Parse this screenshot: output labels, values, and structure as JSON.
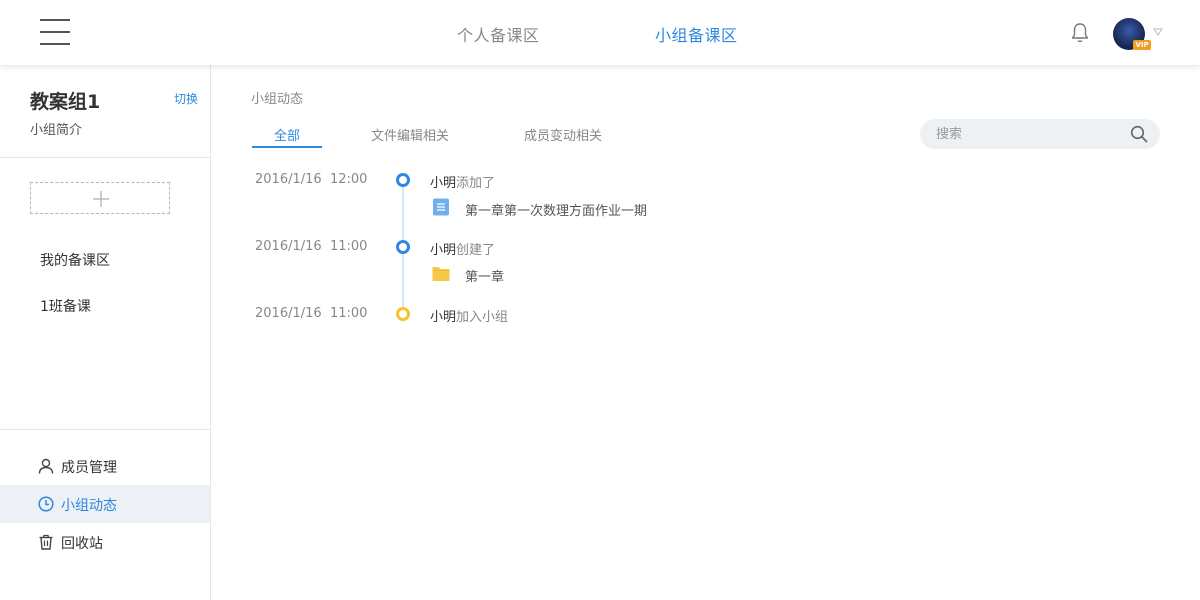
{
  "topbar": {
    "tabs": [
      {
        "label": "个人备课区",
        "active": false
      },
      {
        "label": "小组备课区",
        "active": true
      }
    ],
    "avatar_badge": "VIP",
    "accent_color": "#2f88e0"
  },
  "sidebar": {
    "group_name": "教案组1",
    "switch_label": "切换",
    "intro_label": "小组简介",
    "items": [
      {
        "label": "我的备课区"
      },
      {
        "label": "1班备课"
      }
    ],
    "nav": [
      {
        "label": "成员管理",
        "icon": "user-icon",
        "active": false
      },
      {
        "label": "小组动态",
        "icon": "clock-icon",
        "active": true
      },
      {
        "label": "回收站",
        "icon": "trash-icon",
        "active": false
      }
    ]
  },
  "main": {
    "section_title": "小组动态",
    "filter_tabs": [
      {
        "label": "全部",
        "active": true
      },
      {
        "label": "文件编辑相关",
        "active": false
      },
      {
        "label": "成员变动相关",
        "active": false
      }
    ],
    "search": {
      "placeholder": "搜索",
      "value": ""
    },
    "timeline": [
      {
        "date": "2016/1/16",
        "time": "12:00",
        "user": "小明",
        "action": "添加了",
        "dot_color": "blue",
        "file": {
          "name": "第一章第一次数理方面作业一期",
          "icon": "document-icon"
        }
      },
      {
        "date": "2016/1/16",
        "time": "11:00",
        "user": "小明",
        "action": "创建了",
        "dot_color": "blue",
        "file": {
          "name": "第一章",
          "icon": "folder-icon"
        }
      },
      {
        "date": "2016/1/16",
        "time": "11:00",
        "user": "小明",
        "action": "加入小组",
        "dot_color": "yellow"
      }
    ]
  }
}
